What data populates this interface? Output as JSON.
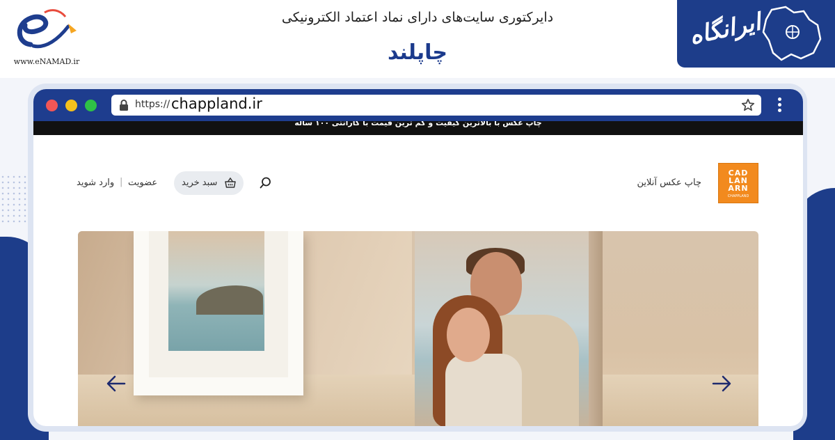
{
  "banner": {
    "enamad_caption": "www.eNAMAD.ir",
    "directory_title": "دایرکتوری سایت‌های دارای نماد اعتماد الکترونیکی",
    "site_name": "چاپلند",
    "brand_text": "ایرانگاه"
  },
  "browser": {
    "url_prefix": "https://",
    "url_domain": "chappland.ir"
  },
  "site": {
    "announcement": "چاپ عکس با بالاترین کیفیت و کم ترین قیمت با گارانتی ۱۰۰ ساله",
    "login_label": "وارد شوید",
    "separator": "|",
    "register_label": "عضویت",
    "cart_label": "سبد خرید",
    "tagline": "چاپ عکس آنلاین",
    "logo_text": "CAD\nLAN\nARN",
    "logo_sub": "CHAPPLAND"
  },
  "colors": {
    "brand_blue": "#1e3d8e",
    "logo_orange": "#f28a1e",
    "arrow": "#1e2a6e"
  },
  "icons": {
    "lock": "lock-icon",
    "star": "star-icon",
    "menu": "kebab-menu-icon",
    "search": "search-icon",
    "cart": "basket-icon",
    "prev": "arrow-left-icon",
    "next": "arrow-right-icon"
  }
}
